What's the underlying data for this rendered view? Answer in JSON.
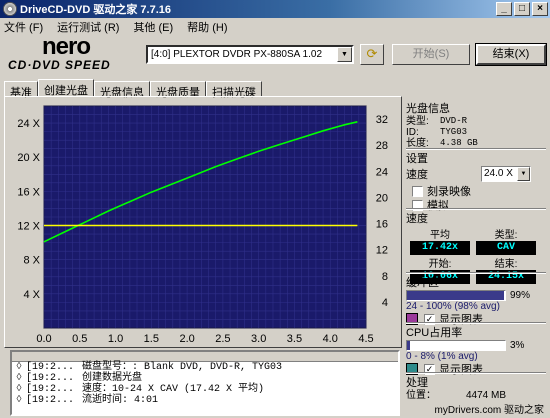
{
  "window": {
    "title": "DriveCD-DVD 驱动之家 7.7.16",
    "min": "_",
    "max": "□",
    "close": "×"
  },
  "menu": [
    "文件 (F)",
    "运行测试 (R)",
    "其他 (E)",
    "帮助 (H)"
  ],
  "logo": {
    "brand": "nero",
    "product": "CD·DVD SPEED"
  },
  "toolbar": {
    "drive": "[4:0]  PLEXTOR DVDR   PX-880SA 1.02",
    "start_label": "开始(S)",
    "exit_label": "结束(X)",
    "refresh_icon": "refresh-icon"
  },
  "tabs": [
    "基准",
    "创建光盘",
    "光盘信息",
    "光盘质量",
    "扫描光碟"
  ],
  "active_tab": 1,
  "chart_data": {
    "type": "line",
    "x_ticks": [
      "0.0",
      "0.5",
      "1.0",
      "1.5",
      "2.0",
      "2.5",
      "3.0",
      "3.5",
      "4.0",
      "4.5"
    ],
    "y_left_ticks": [
      "24 X",
      "20 X",
      "16 X",
      "12 X",
      "8 X",
      "4 X"
    ],
    "y_right_ticks": [
      "32",
      "28",
      "24",
      "20",
      "16",
      "12",
      "8",
      "4"
    ],
    "xlim": [
      0,
      4.5
    ],
    "ylim_left": [
      0,
      26
    ],
    "ylim_right": [
      0,
      34
    ],
    "series": [
      {
        "color": "#00ff00",
        "x": [
          0.0,
          0.3,
          0.6,
          0.9,
          1.2,
          1.5,
          1.8,
          2.1,
          2.4,
          2.7,
          3.0,
          3.3,
          3.6,
          3.9,
          4.2,
          4.38
        ],
        "y": [
          10.1,
          11.3,
          12.5,
          13.7,
          14.8,
          15.9,
          16.9,
          17.9,
          18.9,
          19.8,
          20.7,
          21.5,
          22.3,
          23.1,
          23.8,
          24.15
        ]
      },
      {
        "color": "#ffff00",
        "x": [
          0.0,
          4.38
        ],
        "y": [
          12,
          12
        ]
      }
    ],
    "grid": true,
    "background": "#1a1a6a"
  },
  "log": [
    {
      "time": "[19:2...",
      "text": "磁盘型号：: Blank DVD, DVD-R, TYG03"
    },
    {
      "time": "[19:2...",
      "text": "创建数据光盘"
    },
    {
      "time": "[19:2...",
      "text": "速度：10-24 X CAV (17.42 X 平均)"
    },
    {
      "time": "[19:2...",
      "text": "流逝时间:    4:01"
    }
  ],
  "disc_info": {
    "title": "光盘信息",
    "type_label": "类型:",
    "type_value": "DVD-R",
    "id_label": "ID:",
    "id_value": "TYG03",
    "length_label": "长度:",
    "length_value": "4.38 GB"
  },
  "settings": {
    "title": "设置",
    "speed_label": "速度",
    "speed_value": "24.0 X",
    "record_image": "刻录映像",
    "simulate": "模拟"
  },
  "speed": {
    "title": "速度",
    "avg_label": "平均",
    "avg_value": "17.42x",
    "type_label": "类型:",
    "type_value": "CAV",
    "start_label": "开始:",
    "start_value": "10.06x",
    "end_label": "结束:",
    "end_value": "24.15x"
  },
  "buffer": {
    "title": "缓冲区",
    "percent": "99%",
    "percent_value": 0.99,
    "range": "24 - 100% (98% avg)",
    "show_chart": "显示图表",
    "swatch": "#9b3a9b"
  },
  "cpu": {
    "title": "CPU占用率",
    "percent": "3%",
    "percent_value": 0.03,
    "range": "0 - 8% (1% avg)",
    "show_chart": "显示图表",
    "swatch": "#2e8b8b"
  },
  "process": {
    "title": "处理",
    "position_label": "位置：",
    "position_value": "4474 MB"
  },
  "watermark": "myDrivers.com  驱动之家"
}
